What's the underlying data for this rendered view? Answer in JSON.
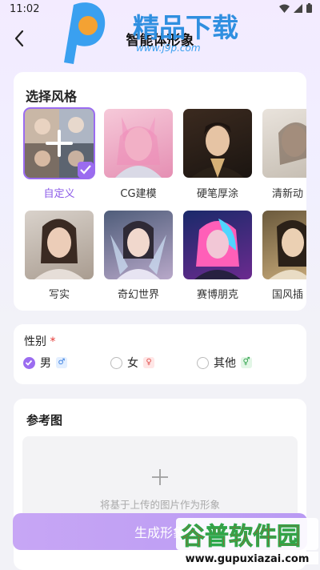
{
  "status": {
    "time": "11:02"
  },
  "nav": {
    "title": "智能体形象"
  },
  "style": {
    "title": "选择风格",
    "items": [
      {
        "label": "自定义",
        "selected": true
      },
      {
        "label": "CG建模"
      },
      {
        "label": "硬笔厚涂"
      },
      {
        "label": "清新动"
      },
      {
        "label": "写实"
      },
      {
        "label": "奇幻世界"
      },
      {
        "label": "赛博朋克"
      },
      {
        "label": "国风插"
      }
    ]
  },
  "gender": {
    "label": "性别",
    "required": "*",
    "options": [
      {
        "label": "男",
        "symbol": "♂",
        "selected": true
      },
      {
        "label": "女",
        "symbol": "♀"
      },
      {
        "label": "其他",
        "symbol": "⚥"
      }
    ]
  },
  "reference": {
    "title": "参考图",
    "hint": "将基于上传的图片作为形象"
  },
  "generate": {
    "label": "生成形象"
  },
  "watermarks": {
    "top_text": "精品下载",
    "top_url": "www.j9p.com",
    "bottom_text": "谷普软件园",
    "bottom_url": "www.gupuxiazai.com"
  },
  "colors": {
    "accent": "#9b6cf0"
  }
}
